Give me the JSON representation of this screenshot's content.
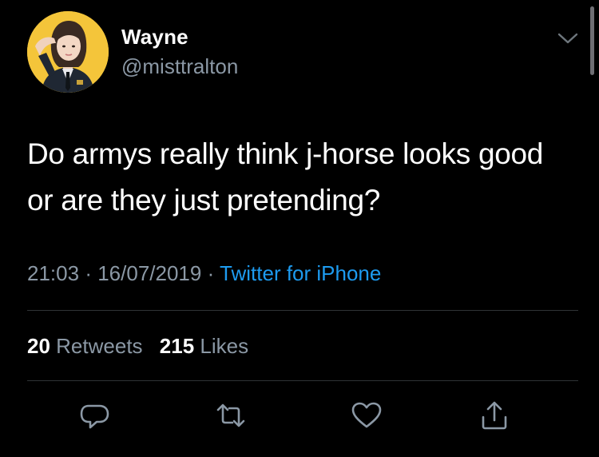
{
  "tweet": {
    "display_name": "Wayne",
    "handle": "@misttralton",
    "text": "Do armys really think j-horse looks good or are they just pretending?",
    "time": "21:03",
    "separator": "·",
    "date": "16/07/2019",
    "source": "Twitter for iPhone"
  },
  "stats": {
    "retweets_count": "20",
    "retweets_label": "Retweets",
    "likes_count": "215",
    "likes_label": "Likes"
  },
  "icons": {
    "menu": "chevron-down-icon",
    "reply": "reply-icon",
    "retweet": "retweet-icon",
    "like": "heart-icon",
    "share": "share-icon"
  },
  "colors": {
    "background": "#000000",
    "primary_text": "#ffffff",
    "secondary_text": "#8b98a5",
    "link": "#1d9bf0",
    "divider": "#2f3336",
    "avatar_background": "#f4c53a"
  }
}
